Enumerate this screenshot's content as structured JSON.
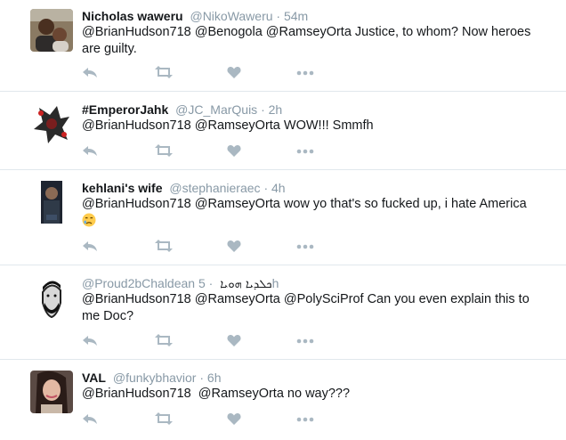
{
  "tweets": [
    {
      "name": "Nicholas waweru",
      "handle": "@NikoWaweru",
      "time": "54m",
      "text": "@BrianHudson718 @Benogola @RamseyOrta Justice, to whom? Now heroes are guilty."
    },
    {
      "name": "#EmperorJahk",
      "handle": "@JC_MarQuis",
      "time": "2h",
      "text": "@BrianHudson718 @RamseyOrta WOW!!! Smmfh"
    },
    {
      "name": "kehlani's wife",
      "handle": "@stephanieraec",
      "time": "4h",
      "text": "@BrianHudson718 @RamseyOrta wow yo that's so fucked up, i hate America"
    },
    {
      "name": "",
      "handle": "@Proud2bChaldean",
      "name_suffix": "ܟܠܕܝܐ ܗܘܝܐ",
      "time": "5h",
      "text": "@BrianHudson718 @RamseyOrta @PolySciProf Can you even explain this to me Doc?"
    },
    {
      "name": "VAL",
      "handle": "@funkybhavior",
      "time": "6h",
      "text": "@BrianHudson718  @RamseyOrta no way???"
    }
  ],
  "separator": "·",
  "icons": {
    "reply": "reply-icon",
    "retweet": "retweet-icon",
    "like": "heart-icon",
    "more": "more-icon"
  },
  "colors": {
    "icon": "#aab8c2",
    "meta": "#8899a6",
    "border": "#e1e8ed"
  }
}
